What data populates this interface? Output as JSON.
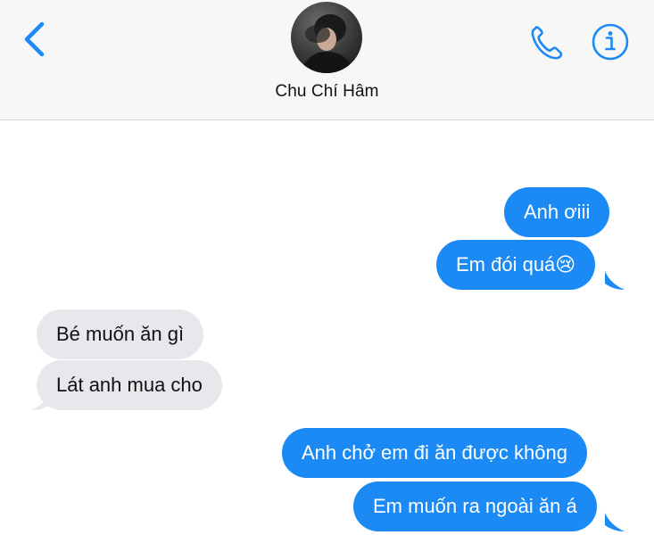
{
  "header": {
    "contact_name": "Chu Chí Hâm",
    "icons": {
      "back": "chevron-left-icon",
      "call": "phone-icon",
      "info": "info-icon"
    }
  },
  "messages": [
    {
      "direction": "sent",
      "text": "Anh ơiii"
    },
    {
      "direction": "sent",
      "text": "Em đói quá😢"
    },
    {
      "direction": "received",
      "text": "Bé muốn ăn gì"
    },
    {
      "direction": "received",
      "text": "Lát anh mua cho"
    },
    {
      "direction": "sent",
      "text": "Anh chở em đi ăn được không"
    },
    {
      "direction": "sent",
      "text": "Em muốn ra ngoài ăn á"
    }
  ],
  "colors": {
    "accent": "#1b8af5",
    "sent_bubble": "#1b8af5",
    "received_bubble": "#e8e8ec",
    "header_bg": "#f7f7f7"
  }
}
